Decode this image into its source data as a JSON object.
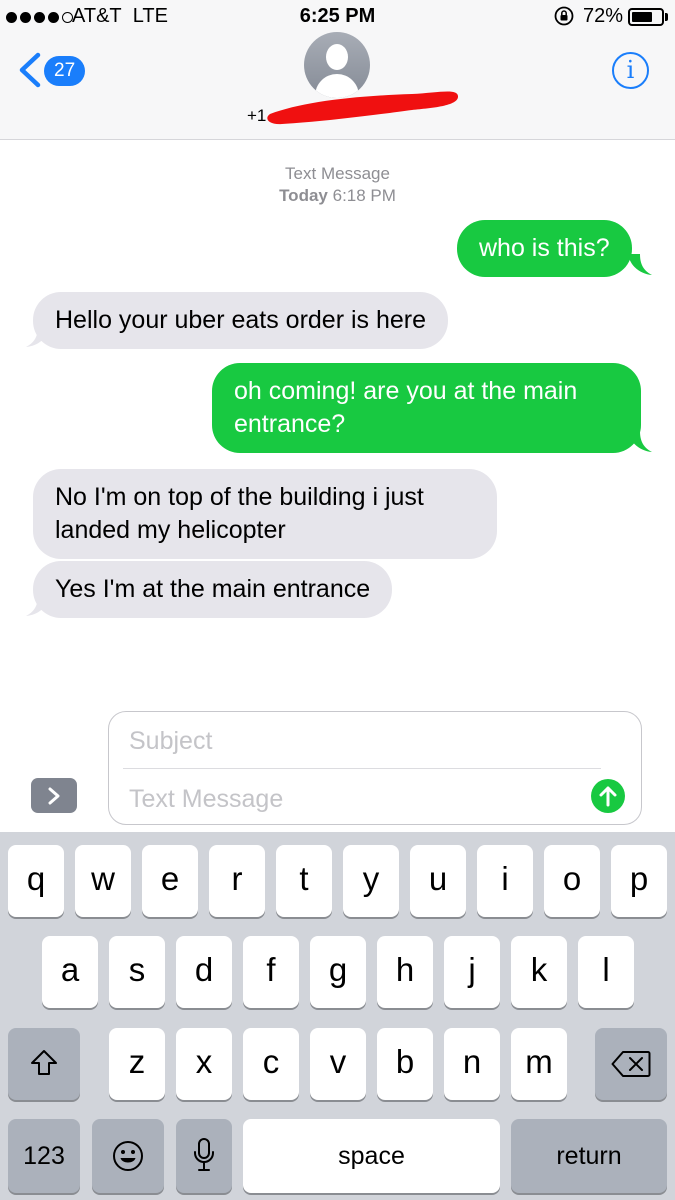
{
  "status_bar": {
    "carrier": "AT&T",
    "network": "LTE",
    "time": "6:25 PM",
    "battery_percent": "72%",
    "battery_level": 0.72,
    "signal_bars": 4,
    "icons": [
      "signal-dots",
      "rotation-lock-icon",
      "battery-icon"
    ]
  },
  "nav": {
    "back_count": "27",
    "contact_number": "+1",
    "icons": [
      "back-chevron-icon",
      "contact-avatar-icon",
      "info-icon"
    ]
  },
  "conversation": {
    "service": "Text Message",
    "day": "Today",
    "time": "6:18 PM",
    "messages": [
      {
        "from": "me",
        "text": "who is this?"
      },
      {
        "from": "them",
        "text": "Hello your uber eats order is here"
      },
      {
        "from": "me",
        "lines": [
          "oh coming! are you at the main",
          "entrance?"
        ]
      },
      {
        "from": "them",
        "lines": [
          "No I'm on top of the building i just",
          "landed my helicopter"
        ]
      },
      {
        "from": "them",
        "text": "Yes I'm at the main entrance"
      }
    ]
  },
  "compose": {
    "subject_placeholder": "Subject",
    "message_placeholder": "Text Message",
    "icons": [
      "expand-chevron-icon",
      "send-arrow-icon"
    ]
  },
  "keyboard": {
    "row1": [
      "q",
      "w",
      "e",
      "r",
      "t",
      "y",
      "u",
      "i",
      "o",
      "p"
    ],
    "row2": [
      "a",
      "s",
      "d",
      "f",
      "g",
      "h",
      "j",
      "k",
      "l"
    ],
    "row3": [
      "z",
      "x",
      "c",
      "v",
      "b",
      "n",
      "m"
    ],
    "numbers_label": "123",
    "space_label": "space",
    "return_label": "return",
    "icons": [
      "shift-icon",
      "backspace-icon",
      "emoji-icon",
      "microphone-icon"
    ]
  },
  "colors": {
    "imessage_blue": "#1a7efb",
    "sms_green": "#18c941",
    "received_gray": "#e6e5eb",
    "keyboard_bg": "#d1d4da"
  }
}
